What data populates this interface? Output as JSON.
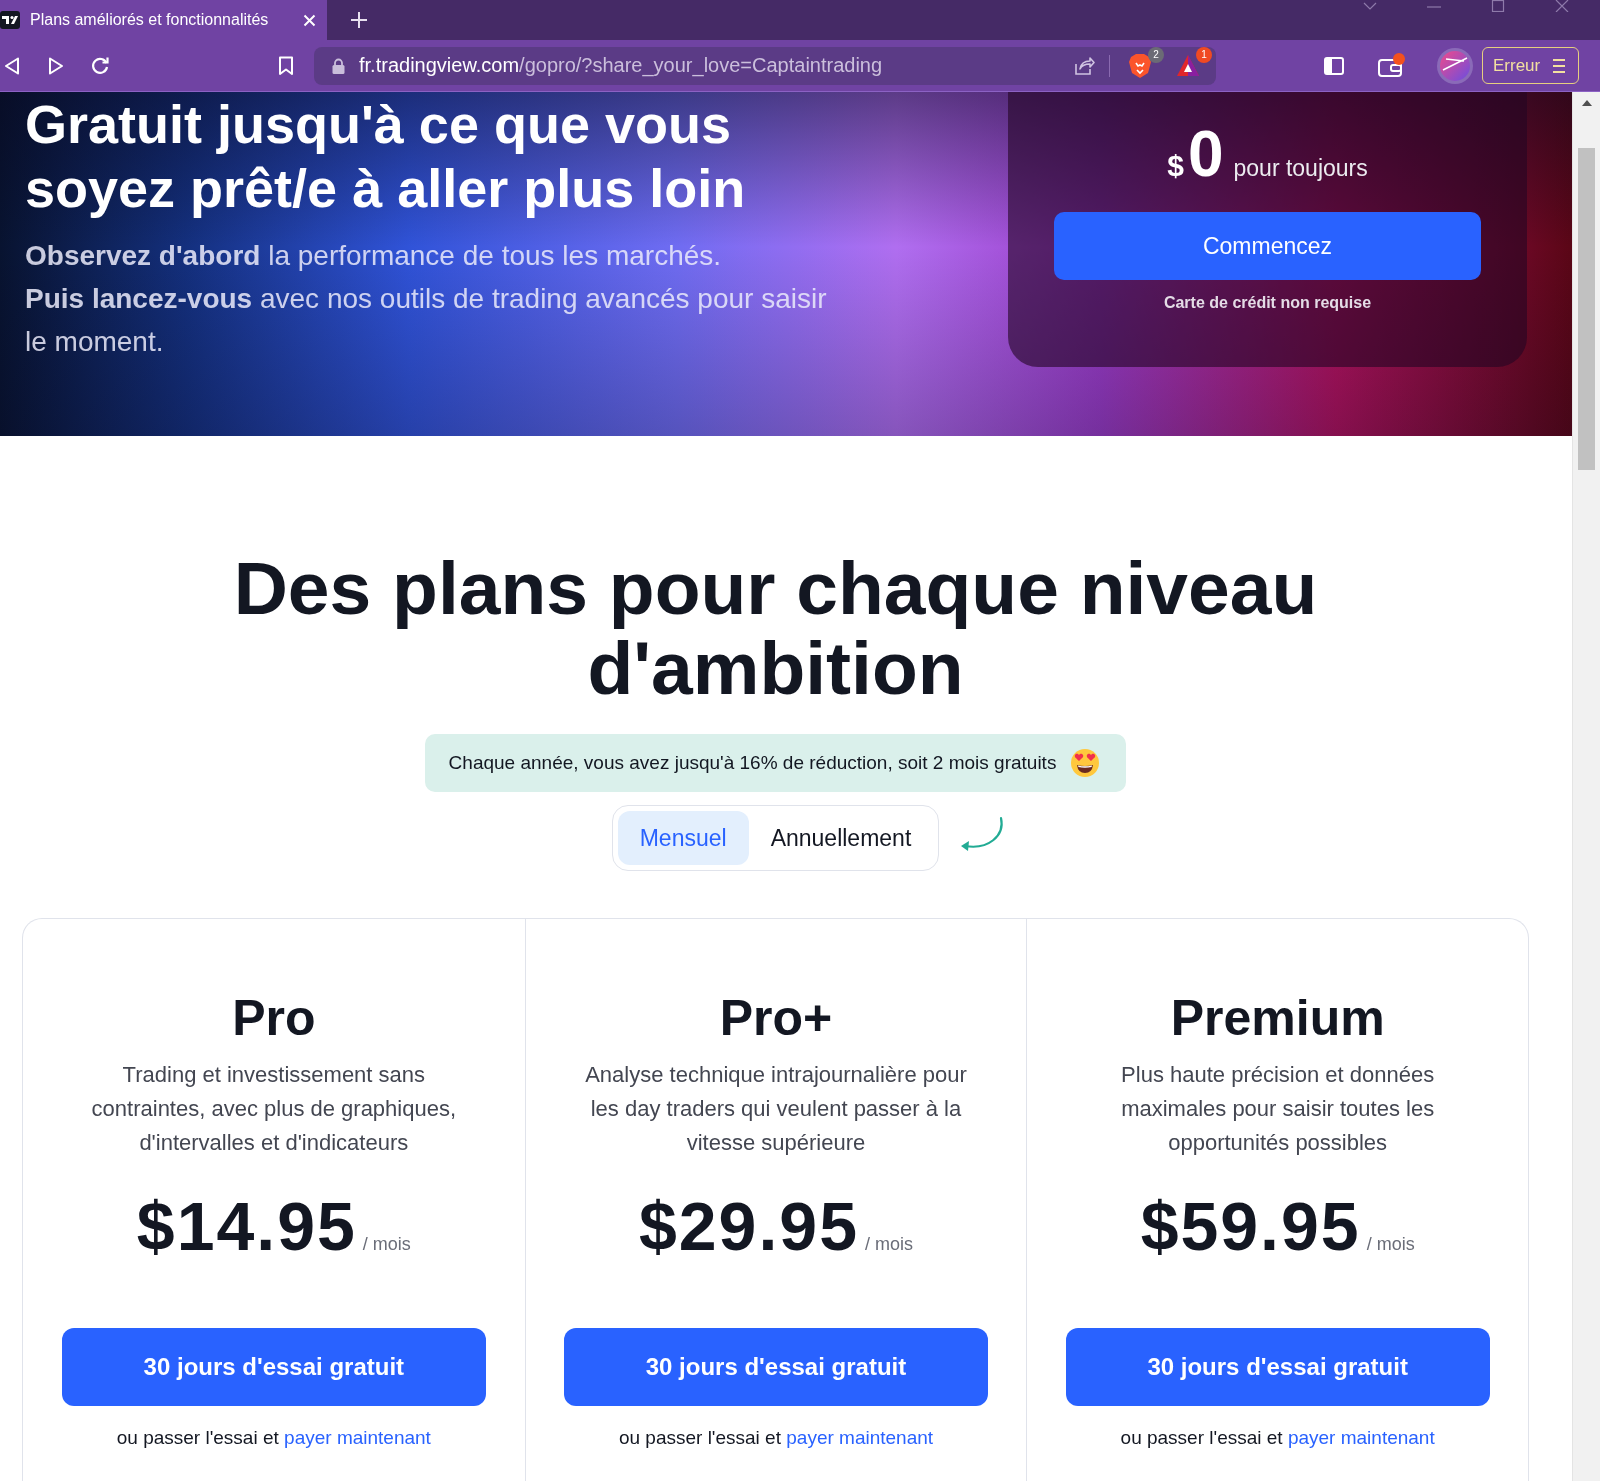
{
  "browser": {
    "tab": {
      "title": "Plans améliorés et fonctionnalités",
      "selected": true
    },
    "url": {
      "host": "fr.tradingview.com",
      "path": "/gopro/?share_your_love=Captaintrading"
    },
    "extension_badges": [
      {
        "kind": "shields",
        "count": "2"
      },
      {
        "kind": "rewards",
        "count": "1"
      }
    ],
    "profile_button": "Erreur"
  },
  "hero": {
    "title": "Gratuit jusqu'à ce que vous soyez prêt/e à aller plus loin",
    "intro": [
      "**Observez d'abord** la performance de tous les marchés.",
      "**Puis lancez-vous** avec nos outils de trading avancés pour saisir le moment."
    ],
    "offer": {
      "currency": "$",
      "amount": "0",
      "period": "pour toujours",
      "button": "Commencez",
      "note": "Carte de crédit non requise"
    }
  },
  "plans_section": {
    "heading": "Des plans pour chaque niveau d'ambition",
    "discount_banner": "Chaque année, vous avez jusqu'à 16% de réduction, soit 2 mois gratuits",
    "billing_options": [
      {
        "label": "Mensuel",
        "selected": true
      },
      {
        "label": "Annuellement",
        "selected": false
      }
    ],
    "plans": [
      {
        "name": "Pro",
        "description": "Trading et investissement sans contraintes, avec plus de graphiques, d'intervalles et d'indicateurs",
        "price": "$14.95",
        "period": "/ mois",
        "trial_button": "30 jours d'essai gratuit",
        "skip_text": "ou passer l'essai et",
        "pay_link": "payer maintenant"
      },
      {
        "name": "Pro+",
        "description": "Analyse technique intrajournalière pour les day traders qui veulent passer à la vitesse supérieure",
        "price": "$29.95",
        "period": "/ mois",
        "trial_button": "30 jours d'essai gratuit",
        "skip_text": "ou passer l'essai et",
        "pay_link": "payer maintenant"
      },
      {
        "name": "Premium",
        "description": "Plus haute précision et données maximales pour saisir toutes les opportunités possibles",
        "price": "$59.95",
        "period": "/ mois",
        "trial_button": "30 jours d'essai gratuit",
        "skip_text": "ou passer l'essai et",
        "pay_link": "payer maintenant"
      }
    ]
  }
}
